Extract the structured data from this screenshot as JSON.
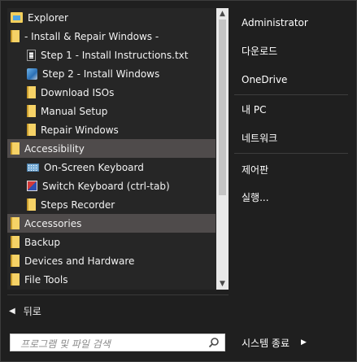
{
  "programs": [
    {
      "label": "Explorer",
      "icon": "explorer-icon",
      "indent": 0,
      "selected": false
    },
    {
      "label": "- Install & Repair Windows -",
      "icon": "folder-icon",
      "indent": 0,
      "selected": false
    },
    {
      "label": "Step 1 - Install Instructions.txt",
      "icon": "text-document-icon",
      "indent": 1,
      "selected": false
    },
    {
      "label": "Step 2 - Install Windows",
      "icon": "setup-icon",
      "indent": 1,
      "selected": false
    },
    {
      "label": "Download ISOs",
      "icon": "folder-icon",
      "indent": 1,
      "selected": false
    },
    {
      "label": "Manual Setup",
      "icon": "folder-icon",
      "indent": 1,
      "selected": false
    },
    {
      "label": "Repair Windows",
      "icon": "folder-icon",
      "indent": 1,
      "selected": false
    },
    {
      "label": "Accessibility",
      "icon": "folder-icon",
      "indent": 0,
      "selected": true
    },
    {
      "label": "On-Screen Keyboard",
      "icon": "keyboard-icon",
      "indent": 1,
      "selected": false
    },
    {
      "label": "Switch Keyboard (ctrl-tab)",
      "icon": "switch-keyboard-icon",
      "indent": 1,
      "selected": false
    },
    {
      "label": "Steps Recorder",
      "icon": "folder-icon",
      "indent": 1,
      "selected": false
    },
    {
      "label": "Accessories",
      "icon": "folder-icon",
      "indent": 0,
      "selected": true
    },
    {
      "label": "Backup",
      "icon": "folder-icon",
      "indent": 0,
      "selected": false
    },
    {
      "label": "Devices and Hardware",
      "icon": "folder-icon",
      "indent": 0,
      "selected": false
    },
    {
      "label": "File Tools",
      "icon": "folder-icon",
      "indent": 0,
      "selected": false
    }
  ],
  "back_label": "뒤로",
  "search": {
    "placeholder": "프로그램 및 파일 검색"
  },
  "right_items": [
    {
      "label": "Administrator",
      "group": 0
    },
    {
      "label": "다운로드",
      "group": 0
    },
    {
      "label": "OneDrive",
      "group": 0
    },
    {
      "label": "내 PC",
      "group": 1
    },
    {
      "label": "네트워크",
      "group": 1
    },
    {
      "label": "제어판",
      "group": 2
    },
    {
      "label": "실행...",
      "group": 2
    }
  ],
  "shutdown_label": "시스템 종료",
  "colors": {
    "selected_bg": "#4f4b4b",
    "folder": "#f6d266"
  }
}
